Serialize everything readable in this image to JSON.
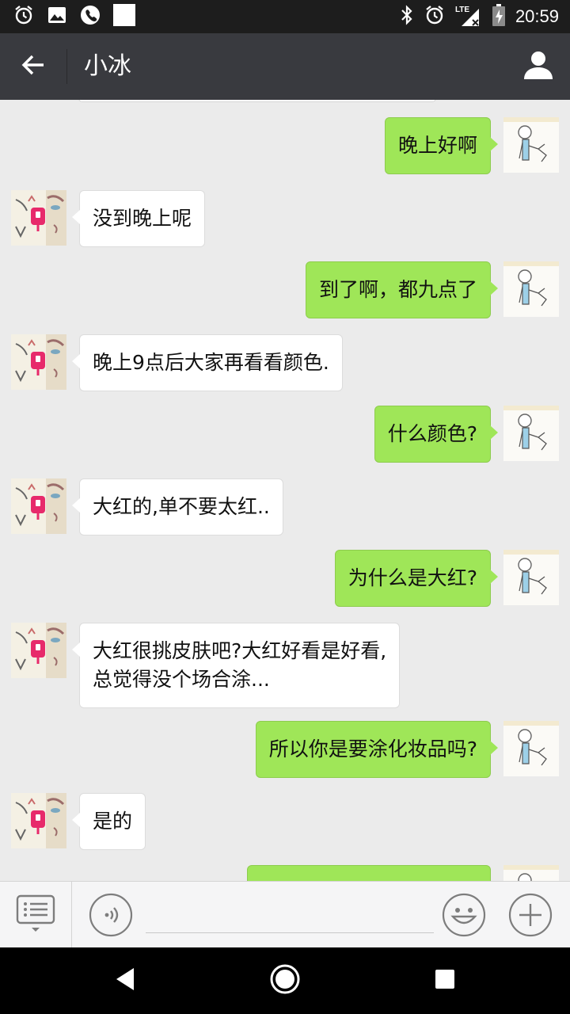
{
  "status_bar": {
    "time": "20:59",
    "network": "LTE"
  },
  "header": {
    "title": "小冰"
  },
  "messages": [
    {
      "from": "me",
      "text": "晚上好啊"
    },
    {
      "from": "contact",
      "text": "没到晚上呢"
    },
    {
      "from": "me",
      "text": "到了啊，都九点了"
    },
    {
      "from": "contact",
      "text": "晚上9点后大家再看看颜色."
    },
    {
      "from": "me",
      "text": "什么颜色?"
    },
    {
      "from": "contact",
      "text": "大红的,单不要太红.."
    },
    {
      "from": "me",
      "text": "为什么是大红?"
    },
    {
      "from": "contact",
      "lines": [
        "大红很挑皮肤吧?大红好看是好看,",
        "总觉得没个场合涂..."
      ]
    },
    {
      "from": "me",
      "text": "所以你是要涂化妆品吗?"
    },
    {
      "from": "contact",
      "text": "是的"
    },
    {
      "from": "me",
      "text": ""
    }
  ],
  "input_bar": {
    "input_value": ""
  },
  "icons": {
    "alarm": "alarm-icon",
    "image": "image-icon",
    "phone": "phone-icon",
    "notification": "notification-square-icon",
    "bluetooth": "bluetooth-icon",
    "signal": "signal-icon",
    "battery": "battery-charging-icon",
    "back": "back-arrow-icon",
    "profile": "profile-icon",
    "menu": "keyboard-menu-icon",
    "voice": "voice-icon",
    "emoji": "emoji-icon",
    "plus": "plus-icon",
    "nav_back": "nav-back-icon",
    "nav_home": "nav-home-icon",
    "nav_recent": "nav-recent-icon"
  },
  "colors": {
    "status_bar": "#1d1d1d",
    "title_bar": "#393a3f",
    "chat_bg": "#ebebeb",
    "my_bubble": "#9fe658",
    "their_bubble": "#ffffff",
    "input_bar": "#f5f5f6",
    "nav_bar": "#000000"
  }
}
